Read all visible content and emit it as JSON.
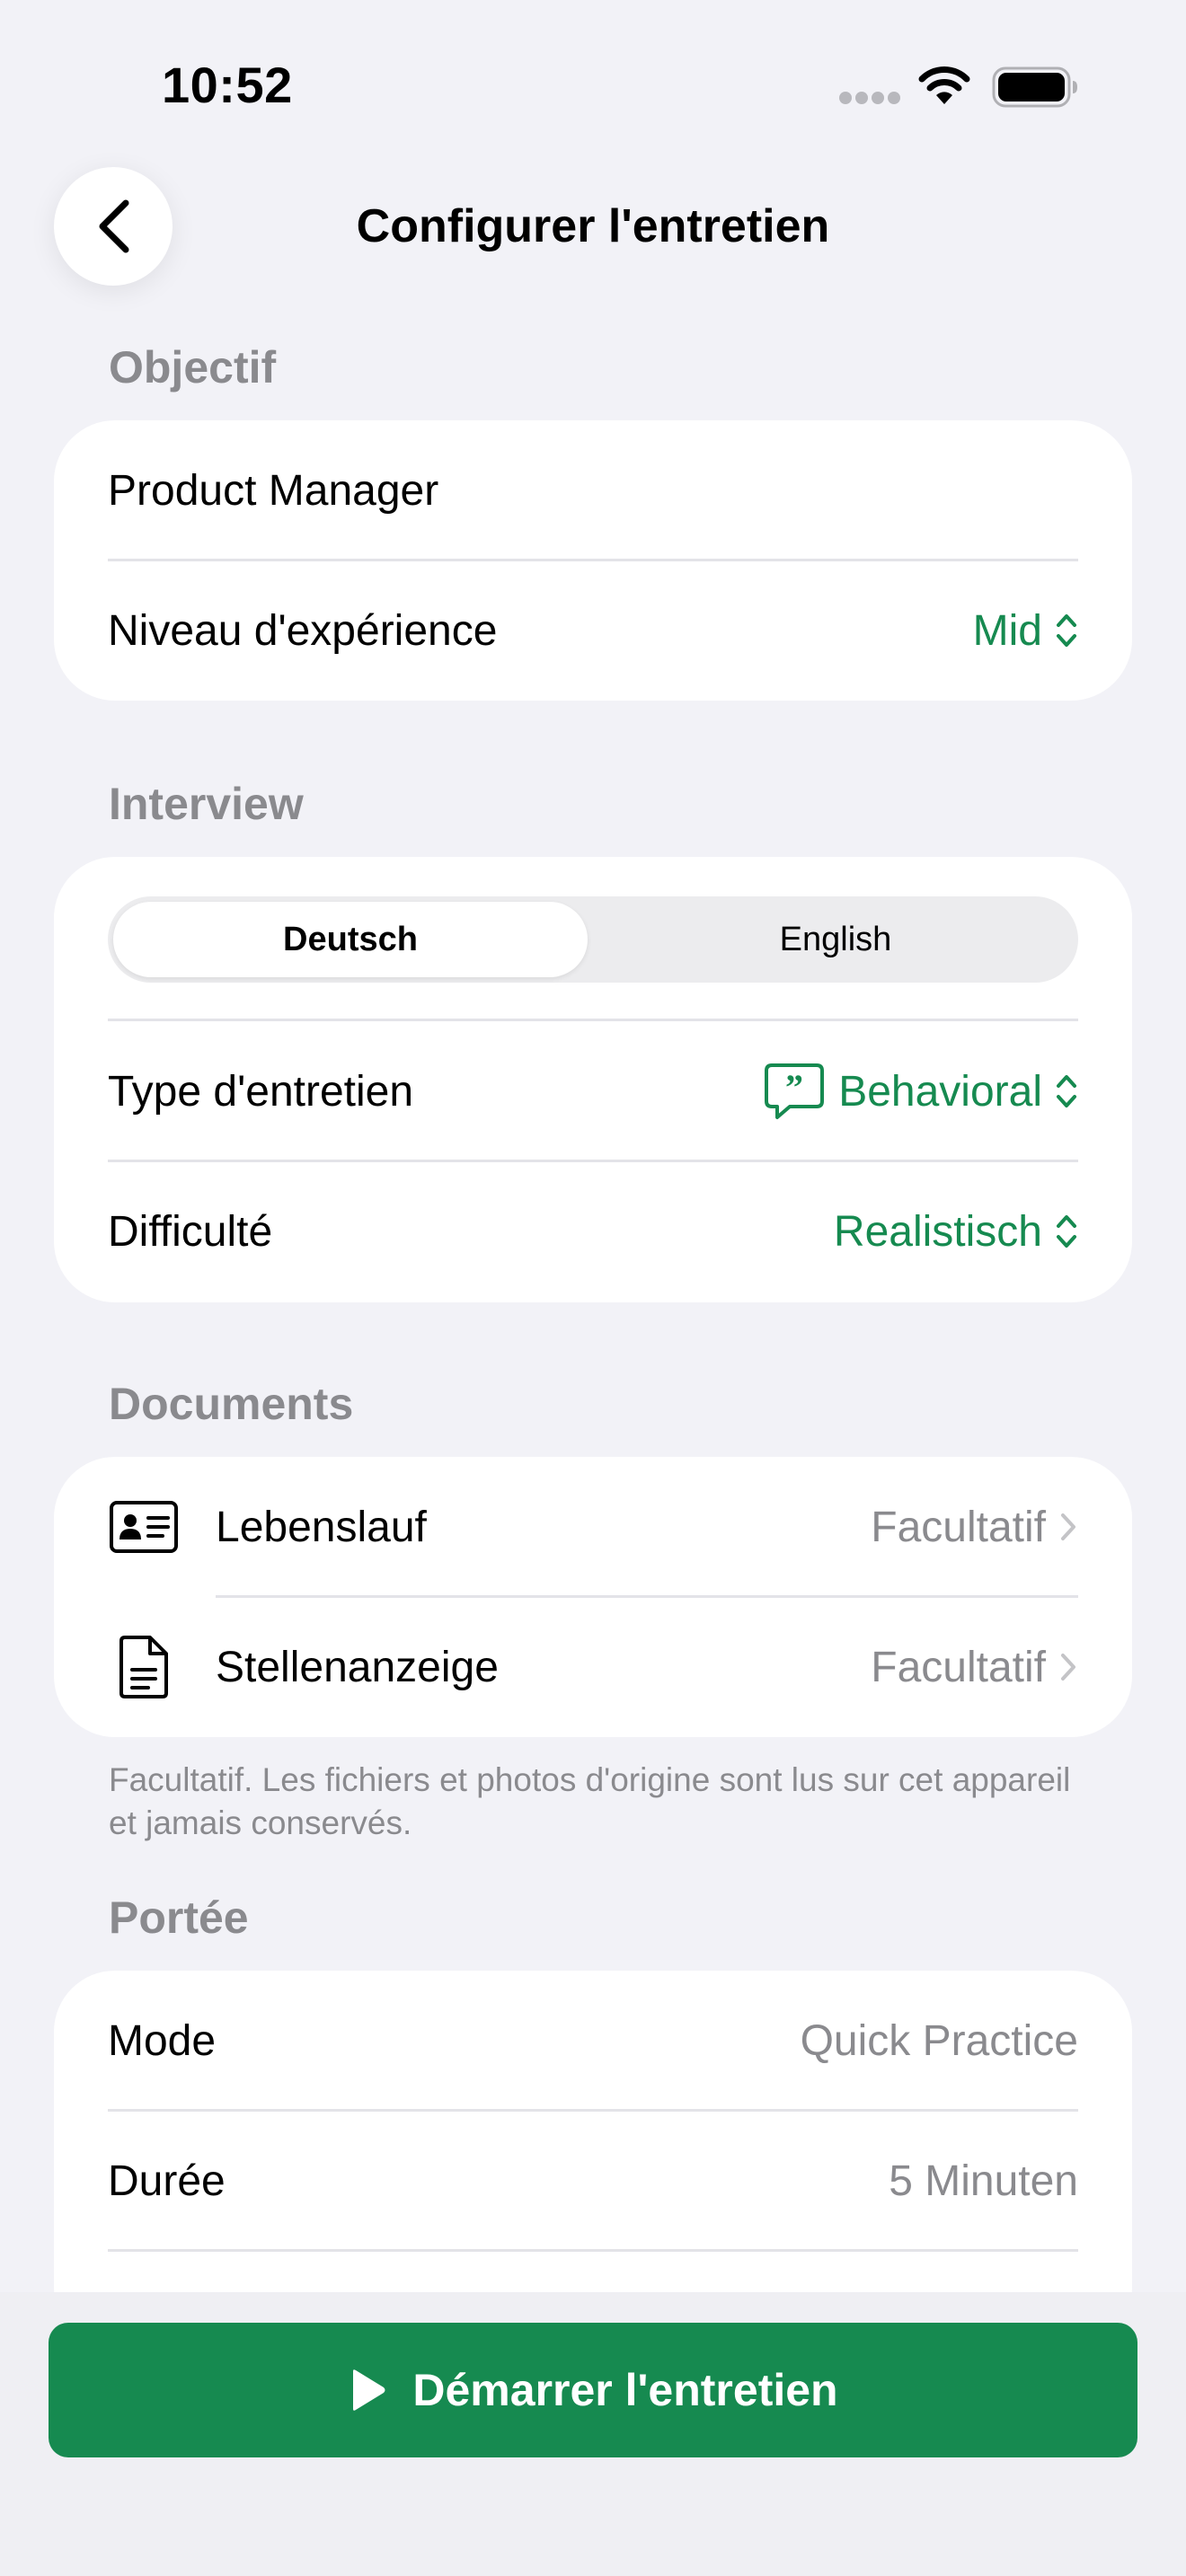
{
  "status_bar": {
    "time": "10:52"
  },
  "nav": {
    "title": "Configurer l'entretien"
  },
  "sections": {
    "objectif": {
      "header": "Objectif",
      "role": "Product Manager",
      "experience_label": "Niveau d'expérience",
      "experience_value": "Mid"
    },
    "interview": {
      "header": "Interview",
      "languages": [
        "Deutsch",
        "English"
      ],
      "selected_language": "Deutsch",
      "type_label": "Type d'entretien",
      "type_value": "Behavioral",
      "difficulty_label": "Difficulté",
      "difficulty_value": "Realistisch"
    },
    "documents": {
      "header": "Documents",
      "items": [
        {
          "label": "Lebenslauf",
          "value": "Facultatif",
          "icon": "id-card-icon"
        },
        {
          "label": "Stellenanzeige",
          "value": "Facultatif",
          "icon": "document-icon"
        }
      ],
      "footnote": "Facultatif. Les fichiers et photos d'origine sont lus sur cet appareil et jamais conservés."
    },
    "portee": {
      "header": "Portée",
      "mode_label": "Mode",
      "mode_value": "Quick Practice",
      "duration_label": "Durée",
      "duration_value": "5 Minuten"
    }
  },
  "start_button": {
    "label": "Démarrer l'entretien"
  },
  "colors": {
    "accent": "#168a50",
    "background": "#f2f2f7",
    "secondary_text": "#8a8a8e"
  }
}
